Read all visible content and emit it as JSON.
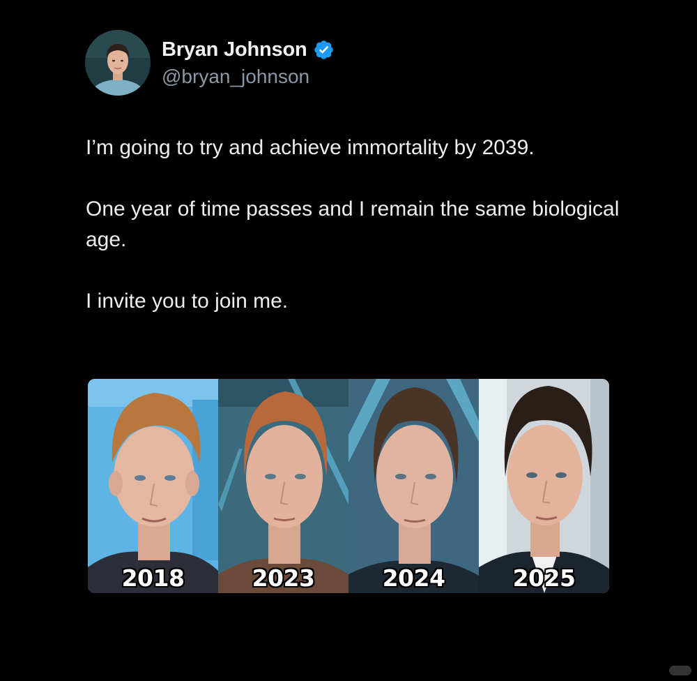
{
  "author": {
    "display_name": "Bryan Johnson",
    "handle": "@bryan_johnson",
    "verified": true,
    "verified_color": "#1d9bf0"
  },
  "tweet": {
    "paragraphs": [
      "I’m going to try and achieve immortality by 2039.",
      "One year of time passes and I remain the same biological age.",
      "I invite you to join me."
    ]
  },
  "media": {
    "panels": [
      {
        "year": "2018",
        "hair": "#b7773d",
        "bg": "#5fb4e6"
      },
      {
        "year": "2023",
        "hair": "#b8683a",
        "bg": "#3b6a7d"
      },
      {
        "year": "2024",
        "hair": "#4a3426",
        "bg": "#3d6880"
      },
      {
        "year": "2025",
        "hair": "#2a1f18",
        "bg": "#cfd6dc"
      }
    ]
  },
  "colors": {
    "background": "#000000",
    "text": "#e7e9ea",
    "secondary_text": "#8b98a5"
  }
}
